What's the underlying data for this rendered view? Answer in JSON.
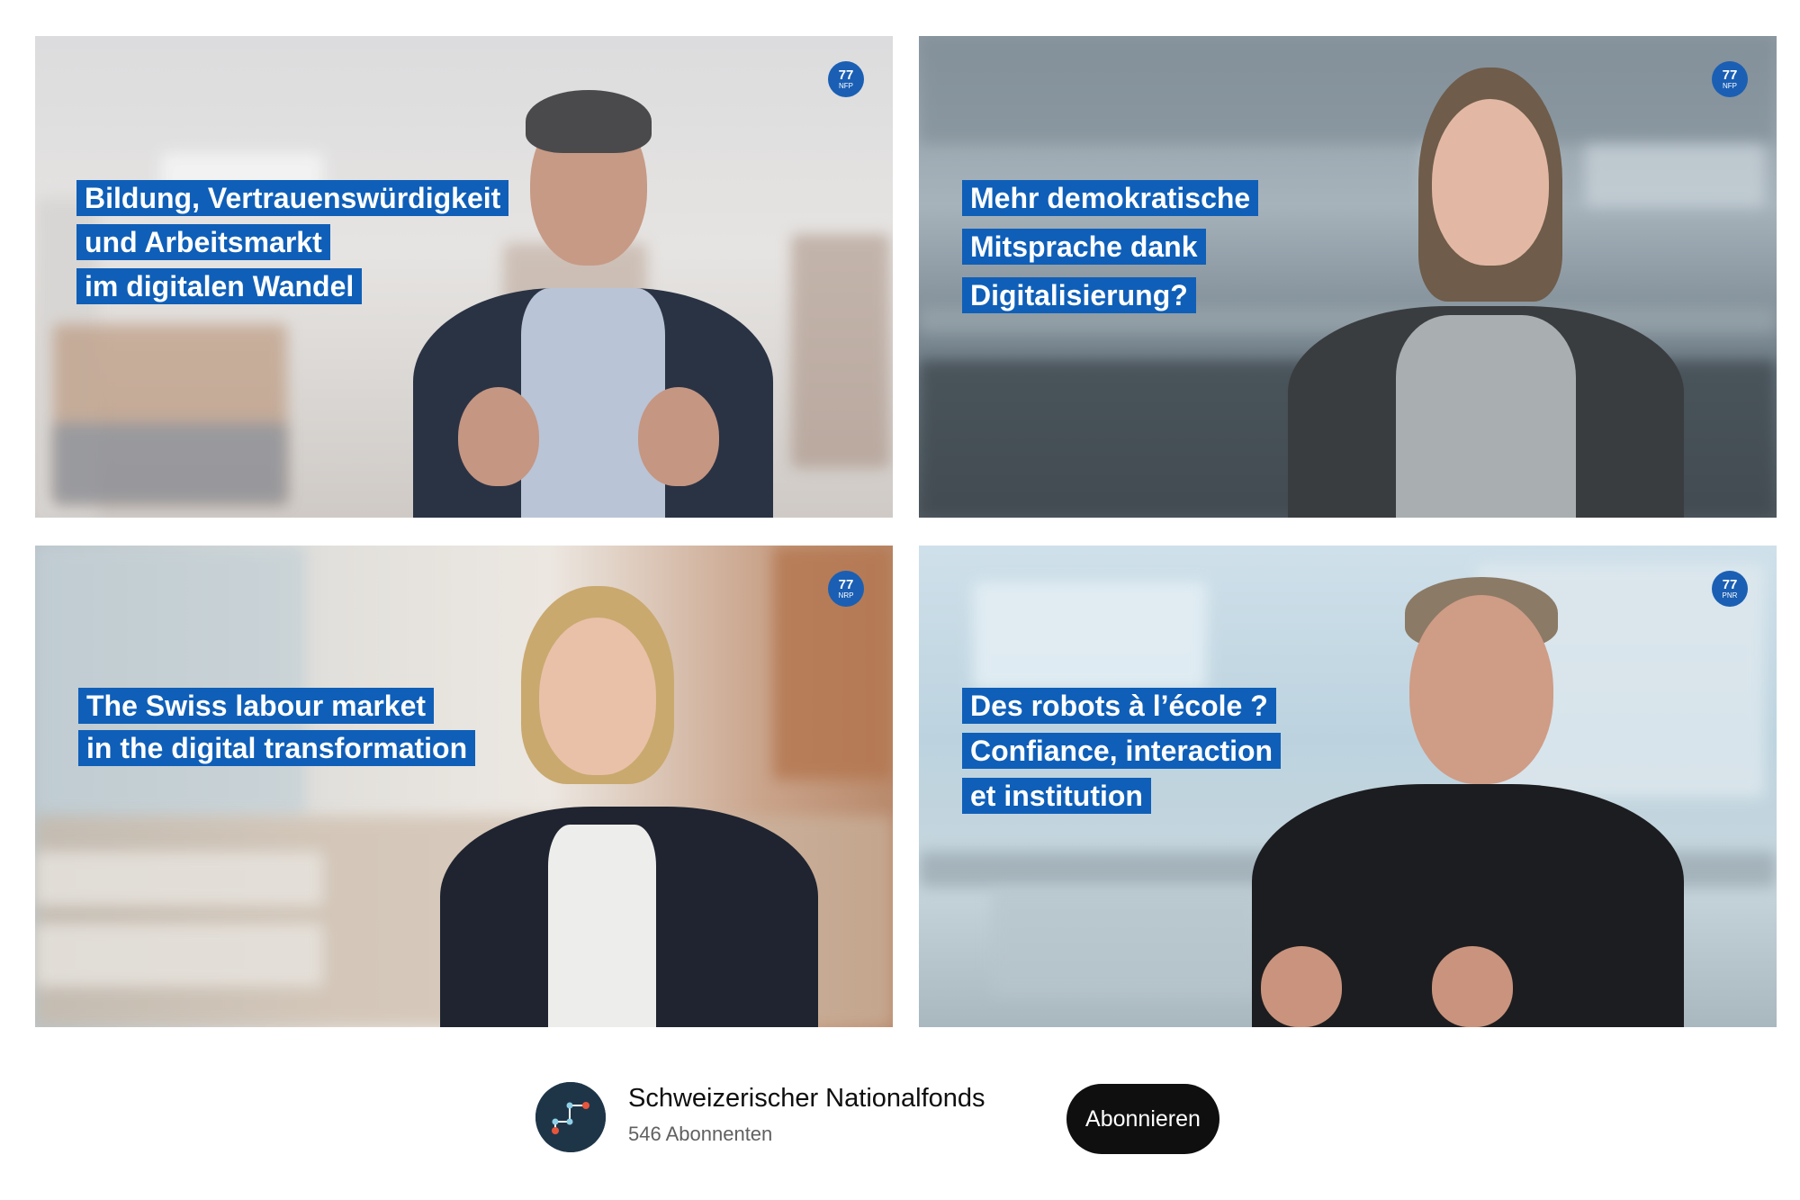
{
  "videos": [
    {
      "badge": {
        "num": "77",
        "abbr": "NFP"
      },
      "title_lines": [
        "Bildung, Vertrauenswürdigkeit",
        "und Arbeitsmarkt",
        "im digitalen Wandel"
      ]
    },
    {
      "badge": {
        "num": "77",
        "abbr": "NFP"
      },
      "title_lines": [
        "Mehr demokratische",
        "Mitsprache dank",
        "Digitalisierung?"
      ]
    },
    {
      "badge": {
        "num": "77",
        "abbr": "NRP"
      },
      "title_lines": [
        "The Swiss labour market",
        "in the digital transformation"
      ]
    },
    {
      "badge": {
        "num": "77",
        "abbr": "PNR"
      },
      "title_lines": [
        "Des robots à l’école ?",
        "Confiance, interaction",
        "et institution"
      ]
    }
  ],
  "channel": {
    "name": "Schweizerischer Nationalfonds",
    "subscribers": "546 Abonnenten",
    "subscribe_label": "Abonnieren",
    "avatar_icon": "snf-logo-icon"
  },
  "colors": {
    "caption_bg": "#0f5fb8",
    "badge_bg": "#1a5fb4",
    "subscribe_bg": "#0f0f0f"
  }
}
